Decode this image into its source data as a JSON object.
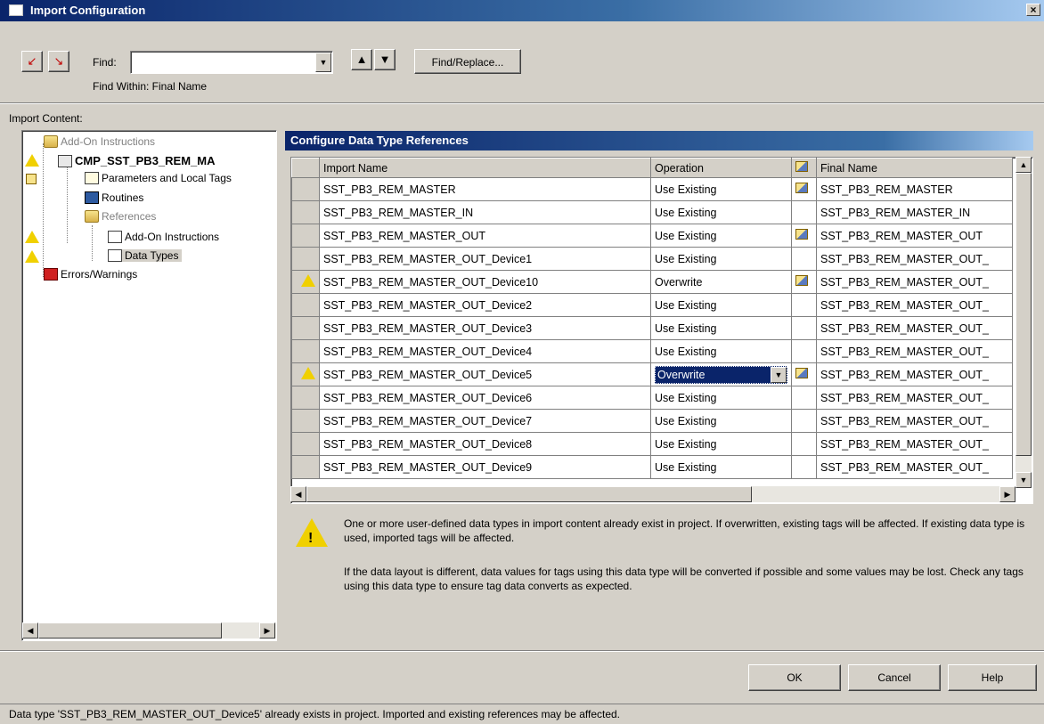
{
  "window": {
    "title": "Import Configuration",
    "close_glyph": "×"
  },
  "toolbar": {
    "prev_icon": "find-previous-icon",
    "next_icon": "find-next-icon",
    "find_label": "Find:",
    "find_value": "",
    "find_within": "Find Within: Final Name",
    "find_replace_label": "Find/Replace..."
  },
  "import_content": {
    "label": "Import Content:",
    "tree": [
      {
        "label": "Add-On Instructions",
        "muted": true
      },
      {
        "label": "CMP_SST_PB3_REM_MA",
        "bold": true
      },
      {
        "label": "Parameters and Local Tags"
      },
      {
        "label": "Routines"
      },
      {
        "label": "References",
        "muted": true
      },
      {
        "label": "Add-On Instructions"
      },
      {
        "label": "Data Types"
      },
      {
        "label": "Errors/Warnings"
      }
    ]
  },
  "grid": {
    "title": "Configure Data Type References",
    "headers": {
      "import_name": "Import Name",
      "operation": "Operation",
      "final_name": "Final Name"
    },
    "rows": [
      {
        "import_name": "SST_PB3_REM_MASTER",
        "operation": "Use Existing",
        "final_name": "SST_PB3_REM_MASTER",
        "final_icon": true,
        "warn": false
      },
      {
        "import_name": "SST_PB3_REM_MASTER_IN",
        "operation": "Use Existing",
        "final_name": "SST_PB3_REM_MASTER_IN",
        "final_icon": false,
        "warn": false
      },
      {
        "import_name": "SST_PB3_REM_MASTER_OUT",
        "operation": "Use Existing",
        "final_name": "SST_PB3_REM_MASTER_OUT",
        "final_icon": true,
        "warn": false
      },
      {
        "import_name": "SST_PB3_REM_MASTER_OUT_Device1",
        "operation": "Use Existing",
        "final_name": "SST_PB3_REM_MASTER_OUT_",
        "final_icon": false,
        "warn": false
      },
      {
        "import_name": "SST_PB3_REM_MASTER_OUT_Device10",
        "operation": "Overwrite",
        "final_name": "SST_PB3_REM_MASTER_OUT_",
        "final_icon": true,
        "warn": true
      },
      {
        "import_name": "SST_PB3_REM_MASTER_OUT_Device2",
        "operation": "Use Existing",
        "final_name": "SST_PB3_REM_MASTER_OUT_",
        "final_icon": false,
        "warn": false
      },
      {
        "import_name": "SST_PB3_REM_MASTER_OUT_Device3",
        "operation": "Use Existing",
        "final_name": "SST_PB3_REM_MASTER_OUT_",
        "final_icon": false,
        "warn": false
      },
      {
        "import_name": "SST_PB3_REM_MASTER_OUT_Device4",
        "operation": "Use Existing",
        "final_name": "SST_PB3_REM_MASTER_OUT_",
        "final_icon": false,
        "warn": false
      },
      {
        "import_name": "SST_PB3_REM_MASTER_OUT_Device5",
        "operation": "Overwrite",
        "final_name": "SST_PB3_REM_MASTER_OUT_",
        "final_icon": true,
        "warn": true,
        "selected": true
      },
      {
        "import_name": "SST_PB3_REM_MASTER_OUT_Device6",
        "operation": "Use Existing",
        "final_name": "SST_PB3_REM_MASTER_OUT_",
        "final_icon": false,
        "warn": false
      },
      {
        "import_name": "SST_PB3_REM_MASTER_OUT_Device7",
        "operation": "Use Existing",
        "final_name": "SST_PB3_REM_MASTER_OUT_",
        "final_icon": false,
        "warn": false
      },
      {
        "import_name": "SST_PB3_REM_MASTER_OUT_Device8",
        "operation": "Use Existing",
        "final_name": "SST_PB3_REM_MASTER_OUT_",
        "final_icon": false,
        "warn": false
      },
      {
        "import_name": "SST_PB3_REM_MASTER_OUT_Device9",
        "operation": "Use Existing",
        "final_name": "SST_PB3_REM_MASTER_OUT_",
        "final_icon": false,
        "warn": false
      }
    ]
  },
  "message": {
    "line1": "One or more user-defined data types in import content already exist in project. If overwritten, existing tags will be affected. If existing data type is used, imported tags will be affected.",
    "line2": "If the data layout is different, data values for tags using this data type will be converted if possible and some values may be lost. Check any tags using this data type to ensure tag data converts as expected."
  },
  "buttons": {
    "ok": "OK",
    "cancel": "Cancel",
    "help": "Help"
  },
  "status": "Data type 'SST_PB3_REM_MASTER_OUT_Device5' already exists in project. Imported and existing references may be affected."
}
